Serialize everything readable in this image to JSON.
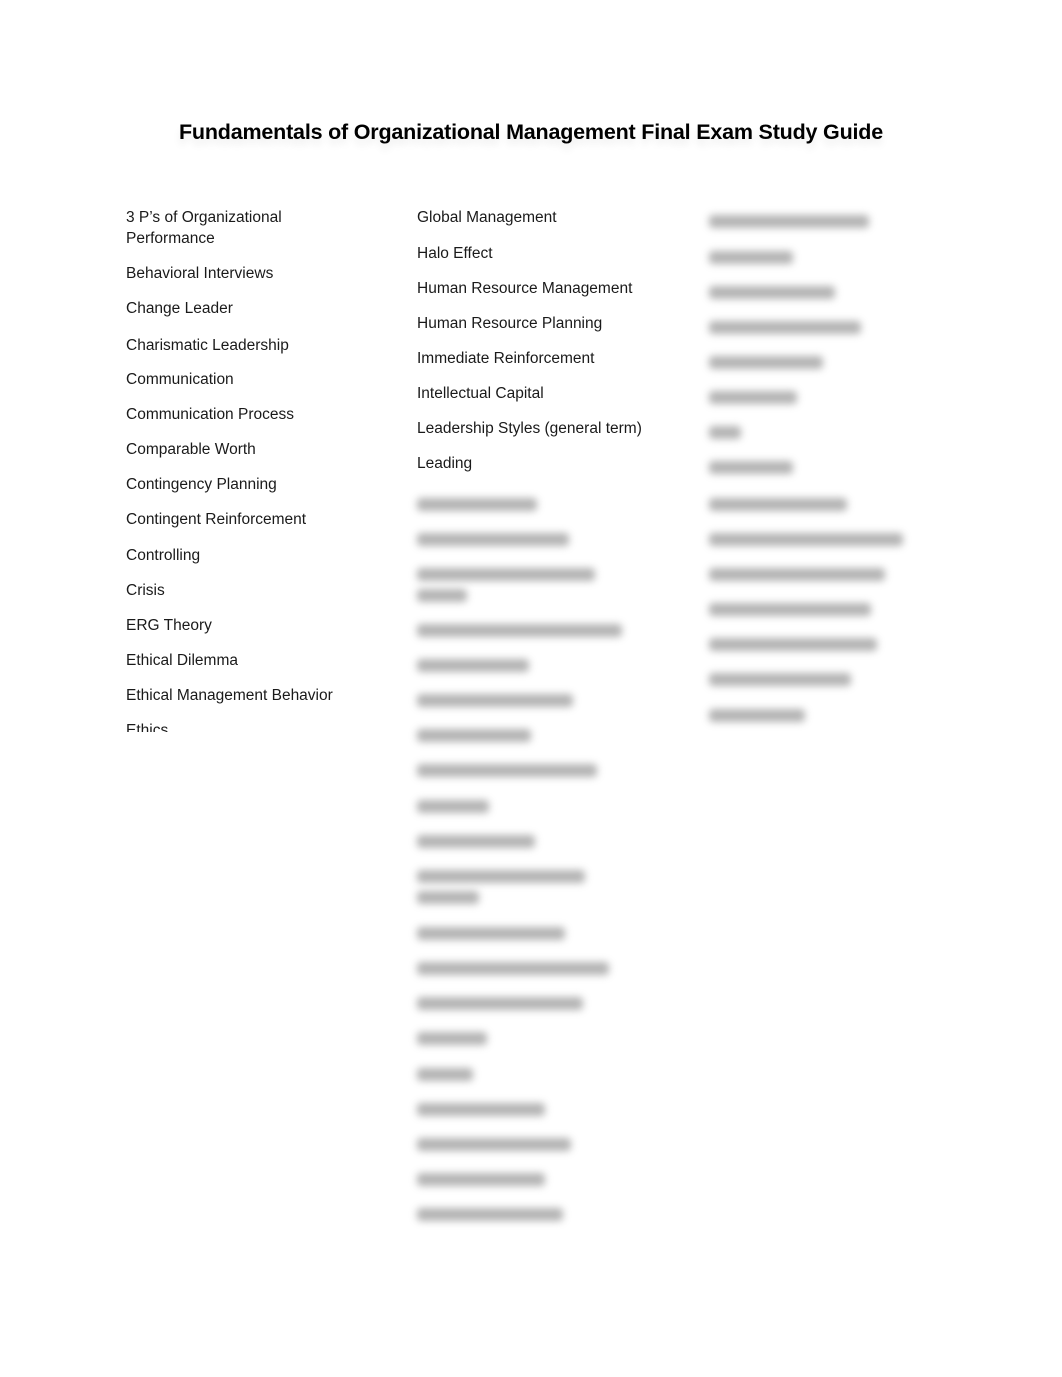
{
  "document": {
    "title": "Fundamentals of Organizational Management Final Exam Study Guide",
    "columns": [
      {
        "visible_terms": [
          "3 P’s of Organizational Performance",
          "Behavioral Interviews",
          "Change Leader",
          "Charismatic Leadership",
          "Communication",
          "Communication Process",
          "Comparable Worth",
          "Contingency Planning",
          "Contingent Reinforcement",
          "Controlling",
          "Crisis",
          "ERG Theory",
          "Ethical Dilemma",
          "Ethical Management Behavior",
          "Ethics"
        ],
        "note": "last term partially cut off"
      },
      {
        "visible_terms": [
          "Global Management",
          "Halo Effect",
          "Human Resource Management",
          "Human Resource Planning",
          "Immediate Reinforcement",
          "Intellectual Capital",
          "Leadership Styles (general term)",
          "Leading"
        ],
        "blurred_term_count": 21
      },
      {
        "visible_terms": [],
        "blurred_term_count": 15
      }
    ]
  }
}
